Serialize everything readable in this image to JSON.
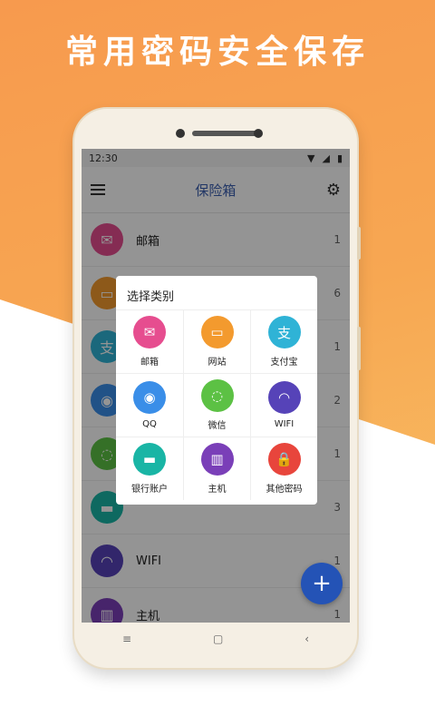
{
  "headline": "常用密码安全保存",
  "status": {
    "time": "12:30"
  },
  "appbar": {
    "title": "保险箱"
  },
  "list": [
    {
      "name": "邮箱",
      "count": "1",
      "color": "#e64d8f",
      "icon": "mail-icon",
      "glyph": "✉"
    },
    {
      "name": "",
      "count": "6",
      "color": "#f39a2e",
      "icon": "website-icon",
      "glyph": "▭"
    },
    {
      "name": "",
      "count": "1",
      "color": "#2fb3d6",
      "icon": "alipay-icon",
      "glyph": "支"
    },
    {
      "name": "",
      "count": "2",
      "color": "#3a8ee8",
      "icon": "qq-icon",
      "glyph": "◉"
    },
    {
      "name": "",
      "count": "1",
      "color": "#5cc144",
      "icon": "wechat-icon",
      "glyph": "◌"
    },
    {
      "name": "",
      "count": "3",
      "color": "#19b5a5",
      "icon": "bank-card-icon",
      "glyph": "▬"
    },
    {
      "name": "WIFI",
      "count": "1",
      "color": "#5643b8",
      "icon": "wifi-router-icon",
      "glyph": "◠"
    },
    {
      "name": "主机",
      "count": "1",
      "color": "#7a3fb8",
      "icon": "server-icon",
      "glyph": "▥"
    }
  ],
  "dialog": {
    "title": "选择类别",
    "items": [
      {
        "label": "邮箱",
        "color": "#e64d8f",
        "icon": "mail-icon",
        "glyph": "✉"
      },
      {
        "label": "网站",
        "color": "#f39a2e",
        "icon": "website-icon",
        "glyph": "▭"
      },
      {
        "label": "支付宝",
        "color": "#2fb3d6",
        "icon": "alipay-icon",
        "glyph": "支"
      },
      {
        "label": "QQ",
        "color": "#3a8ee8",
        "icon": "qq-icon",
        "glyph": "◉"
      },
      {
        "label": "微信",
        "color": "#5cc144",
        "icon": "wechat-icon",
        "glyph": "◌"
      },
      {
        "label": "WIFI",
        "color": "#5643b8",
        "icon": "wifi-router-icon",
        "glyph": "◠"
      },
      {
        "label": "银行账户",
        "color": "#19b5a5",
        "icon": "bank-card-icon",
        "glyph": "▬"
      },
      {
        "label": "主机",
        "color": "#7a3fb8",
        "icon": "server-icon",
        "glyph": "▥"
      },
      {
        "label": "其他密码",
        "color": "#e8453c",
        "icon": "lock-icon",
        "glyph": "🔒"
      }
    ]
  },
  "fab": {
    "label": "+"
  },
  "navbar": {
    "menu": "≡",
    "home": "▢",
    "back": "‹"
  }
}
